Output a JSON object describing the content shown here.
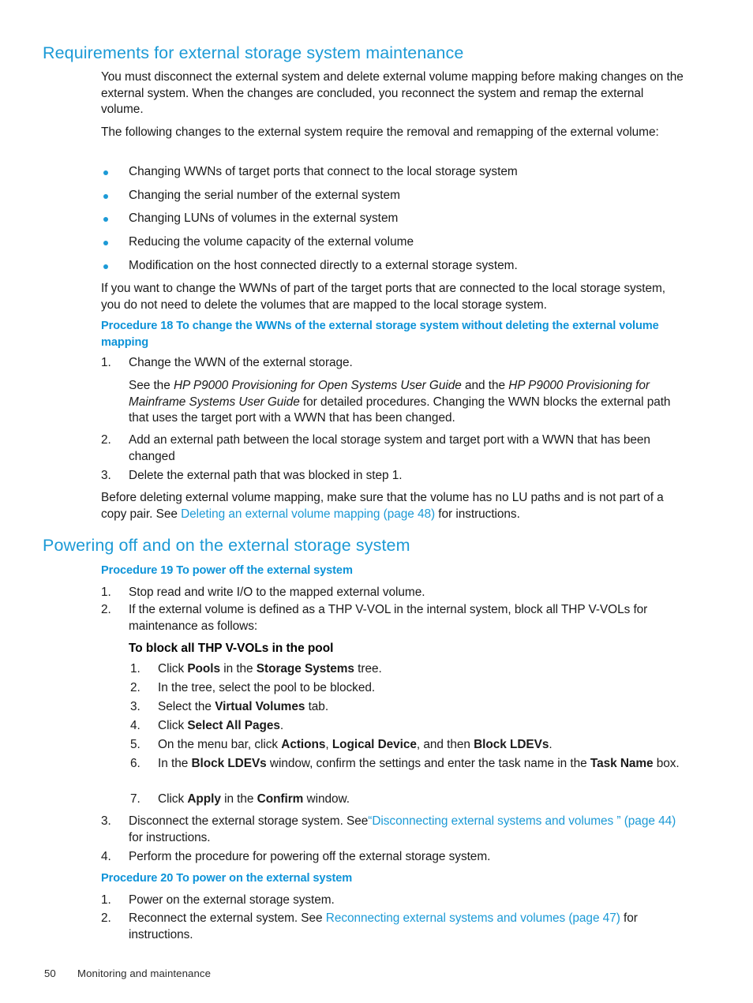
{
  "page": {
    "number": "50",
    "footer_title": "Monitoring and maintenance"
  },
  "colors": {
    "heading_blue": "#1c9ad6",
    "procedure_blue": "#0d93d8",
    "link_blue": "#1c9ad6",
    "body_black": "#1a1a1a",
    "bullet_blue": "#1c9ad6"
  },
  "section1": {
    "heading": "Requirements for external storage system maintenance",
    "para1": "You must disconnect the external system and delete external volume mapping before making changes on the external system. When the changes are concluded, you reconnect the system and remap the external volume.",
    "para2": "The following changes to the external system require the removal and remapping of the external volume:",
    "bullets": [
      "Changing WWNs of target ports that connect to the local storage system",
      "Changing the serial number of the external system",
      "Changing LUNs of volumes in the external system",
      "Reducing the volume capacity of the external volume",
      "Modification on the host connected directly to a external storage system."
    ],
    "para3": "If you want to change the WWNs of part of the target ports that are connected to the local storage system, you do not need to delete the volumes that are mapped to the local storage system.",
    "procedure18": {
      "heading": "Procedure 18 To change the WWNs of the external storage system without deleting the external volume mapping",
      "steps": [
        {
          "num": "1.",
          "text": "Change the WWN of the external storage."
        },
        {
          "num": "2.",
          "text": "Add an external path between the local storage system and target port with a WWN that has been changed"
        },
        {
          "num": "3.",
          "text": "Delete the external path that was blocked in step 1."
        }
      ],
      "step1_note": {
        "prefix": "See the ",
        "guide1": "HP P9000 Provisioning for Open Systems User Guide",
        "mid": " and the ",
        "guide2": "HP P9000 Provisioning for Mainframe Systems User Guide",
        "suffix": " for detailed procedures. Changing the WWN blocks the external path that uses the target port with a WWN that has been changed."
      }
    },
    "closing": {
      "prefix": "Before deleting external volume mapping, make sure that the volume has no LU paths and is not part of a copy pair. See ",
      "link": "Deleting an external volume mapping (page 48)",
      "suffix": " for instructions."
    }
  },
  "section2": {
    "heading": "Powering off and on the external storage system",
    "procedure19": {
      "heading": "Procedure 19 To power off the external system",
      "step1": "Stop read and write I/O to the mapped external volume.",
      "step2": "If the external volume is defined as a THP V-VOL in the internal system, block all THP V-VOLs for maintenance as follows:",
      "subhead": "To block all THP V-VOLs in the pool",
      "substeps": [
        {
          "num": "1.",
          "parts": [
            {
              "t": "Click ",
              "s": "n"
            },
            {
              "t": "Pools",
              "s": "b"
            },
            {
              "t": " in the ",
              "s": "n"
            },
            {
              "t": "Storage Systems",
              "s": "b"
            },
            {
              "t": " tree.",
              "s": "n"
            }
          ]
        },
        {
          "num": "2.",
          "parts": [
            {
              "t": "In the tree, select the pool to be blocked.",
              "s": "n"
            }
          ]
        },
        {
          "num": "3.",
          "parts": [
            {
              "t": "Select the ",
              "s": "n"
            },
            {
              "t": "Virtual Volumes",
              "s": "b"
            },
            {
              "t": " tab.",
              "s": "n"
            }
          ]
        },
        {
          "num": "4.",
          "parts": [
            {
              "t": "Click ",
              "s": "n"
            },
            {
              "t": "Select All Pages",
              "s": "b"
            },
            {
              "t": ".",
              "s": "n"
            }
          ]
        },
        {
          "num": "5.",
          "parts": [
            {
              "t": "On the menu bar, click ",
              "s": "n"
            },
            {
              "t": "Actions",
              "s": "b"
            },
            {
              "t": ", ",
              "s": "n"
            },
            {
              "t": "Logical Device",
              "s": "b"
            },
            {
              "t": ", and then ",
              "s": "n"
            },
            {
              "t": "Block LDEVs",
              "s": "b"
            },
            {
              "t": ".",
              "s": "n"
            }
          ]
        },
        {
          "num": "6.",
          "parts": [
            {
              "t": "In the ",
              "s": "n"
            },
            {
              "t": "Block LDEVs",
              "s": "b"
            },
            {
              "t": " window, confirm the settings and enter the task name in the ",
              "s": "n"
            },
            {
              "t": "Task Name",
              "s": "b"
            },
            {
              "t": " box.",
              "s": "n"
            }
          ]
        },
        {
          "num": "7.",
          "parts": [
            {
              "t": "Click ",
              "s": "n"
            },
            {
              "t": "Apply",
              "s": "b"
            },
            {
              "t": " in the ",
              "s": "n"
            },
            {
              "t": "Confirm",
              "s": "b"
            },
            {
              "t": " window.",
              "s": "n"
            }
          ]
        }
      ],
      "step3": {
        "prefix": "Disconnect the external storage system. See",
        "link": "“Disconnecting external systems and volumes ” (page 44)",
        "suffix": " for instructions."
      },
      "step4": "Perform the procedure for powering off the external storage system."
    },
    "procedure20": {
      "heading": "Procedure 20 To power on the external system",
      "step1": "Power on the external storage system.",
      "step2": {
        "prefix": "Reconnect the external system. See ",
        "link": "Reconnecting external systems and volumes (page 47)",
        "suffix": " for instructions."
      }
    }
  }
}
